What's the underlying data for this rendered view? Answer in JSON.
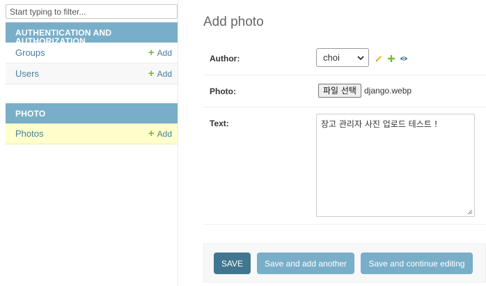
{
  "sidebar": {
    "filter_placeholder": "Start typing to filter...",
    "modules": [
      {
        "caption": "AUTHENTICATION AND AUTHORIZATION",
        "items": [
          {
            "label": "Groups",
            "add": "Add"
          },
          {
            "label": "Users",
            "add": "Add"
          }
        ]
      },
      {
        "caption": "PHOTO",
        "items": [
          {
            "label": "Photos",
            "add": "Add"
          }
        ]
      }
    ]
  },
  "main": {
    "title": "Add photo",
    "fields": {
      "author": {
        "label": "Author:",
        "value": "choi"
      },
      "photo": {
        "label": "Photo:",
        "button": "파일 선택",
        "filename": "django.webp"
      },
      "text": {
        "label": "Text:",
        "value": "장고 관리자 사진 업로드 테스트 !"
      }
    },
    "buttons": {
      "save": "SAVE",
      "save_add_another": "Save and add another",
      "save_continue": "Save and continue editing"
    }
  },
  "colors": {
    "module_caption": "#79aec8",
    "link": "#447e9b",
    "add_plus": "#70bf2b",
    "save_button": "#417690",
    "current_row": "#ffffcc"
  },
  "icons": {
    "edit": "pencil-icon",
    "add_related": "plus-icon",
    "view_related": "eye-icon",
    "add_link": "plus-icon"
  }
}
